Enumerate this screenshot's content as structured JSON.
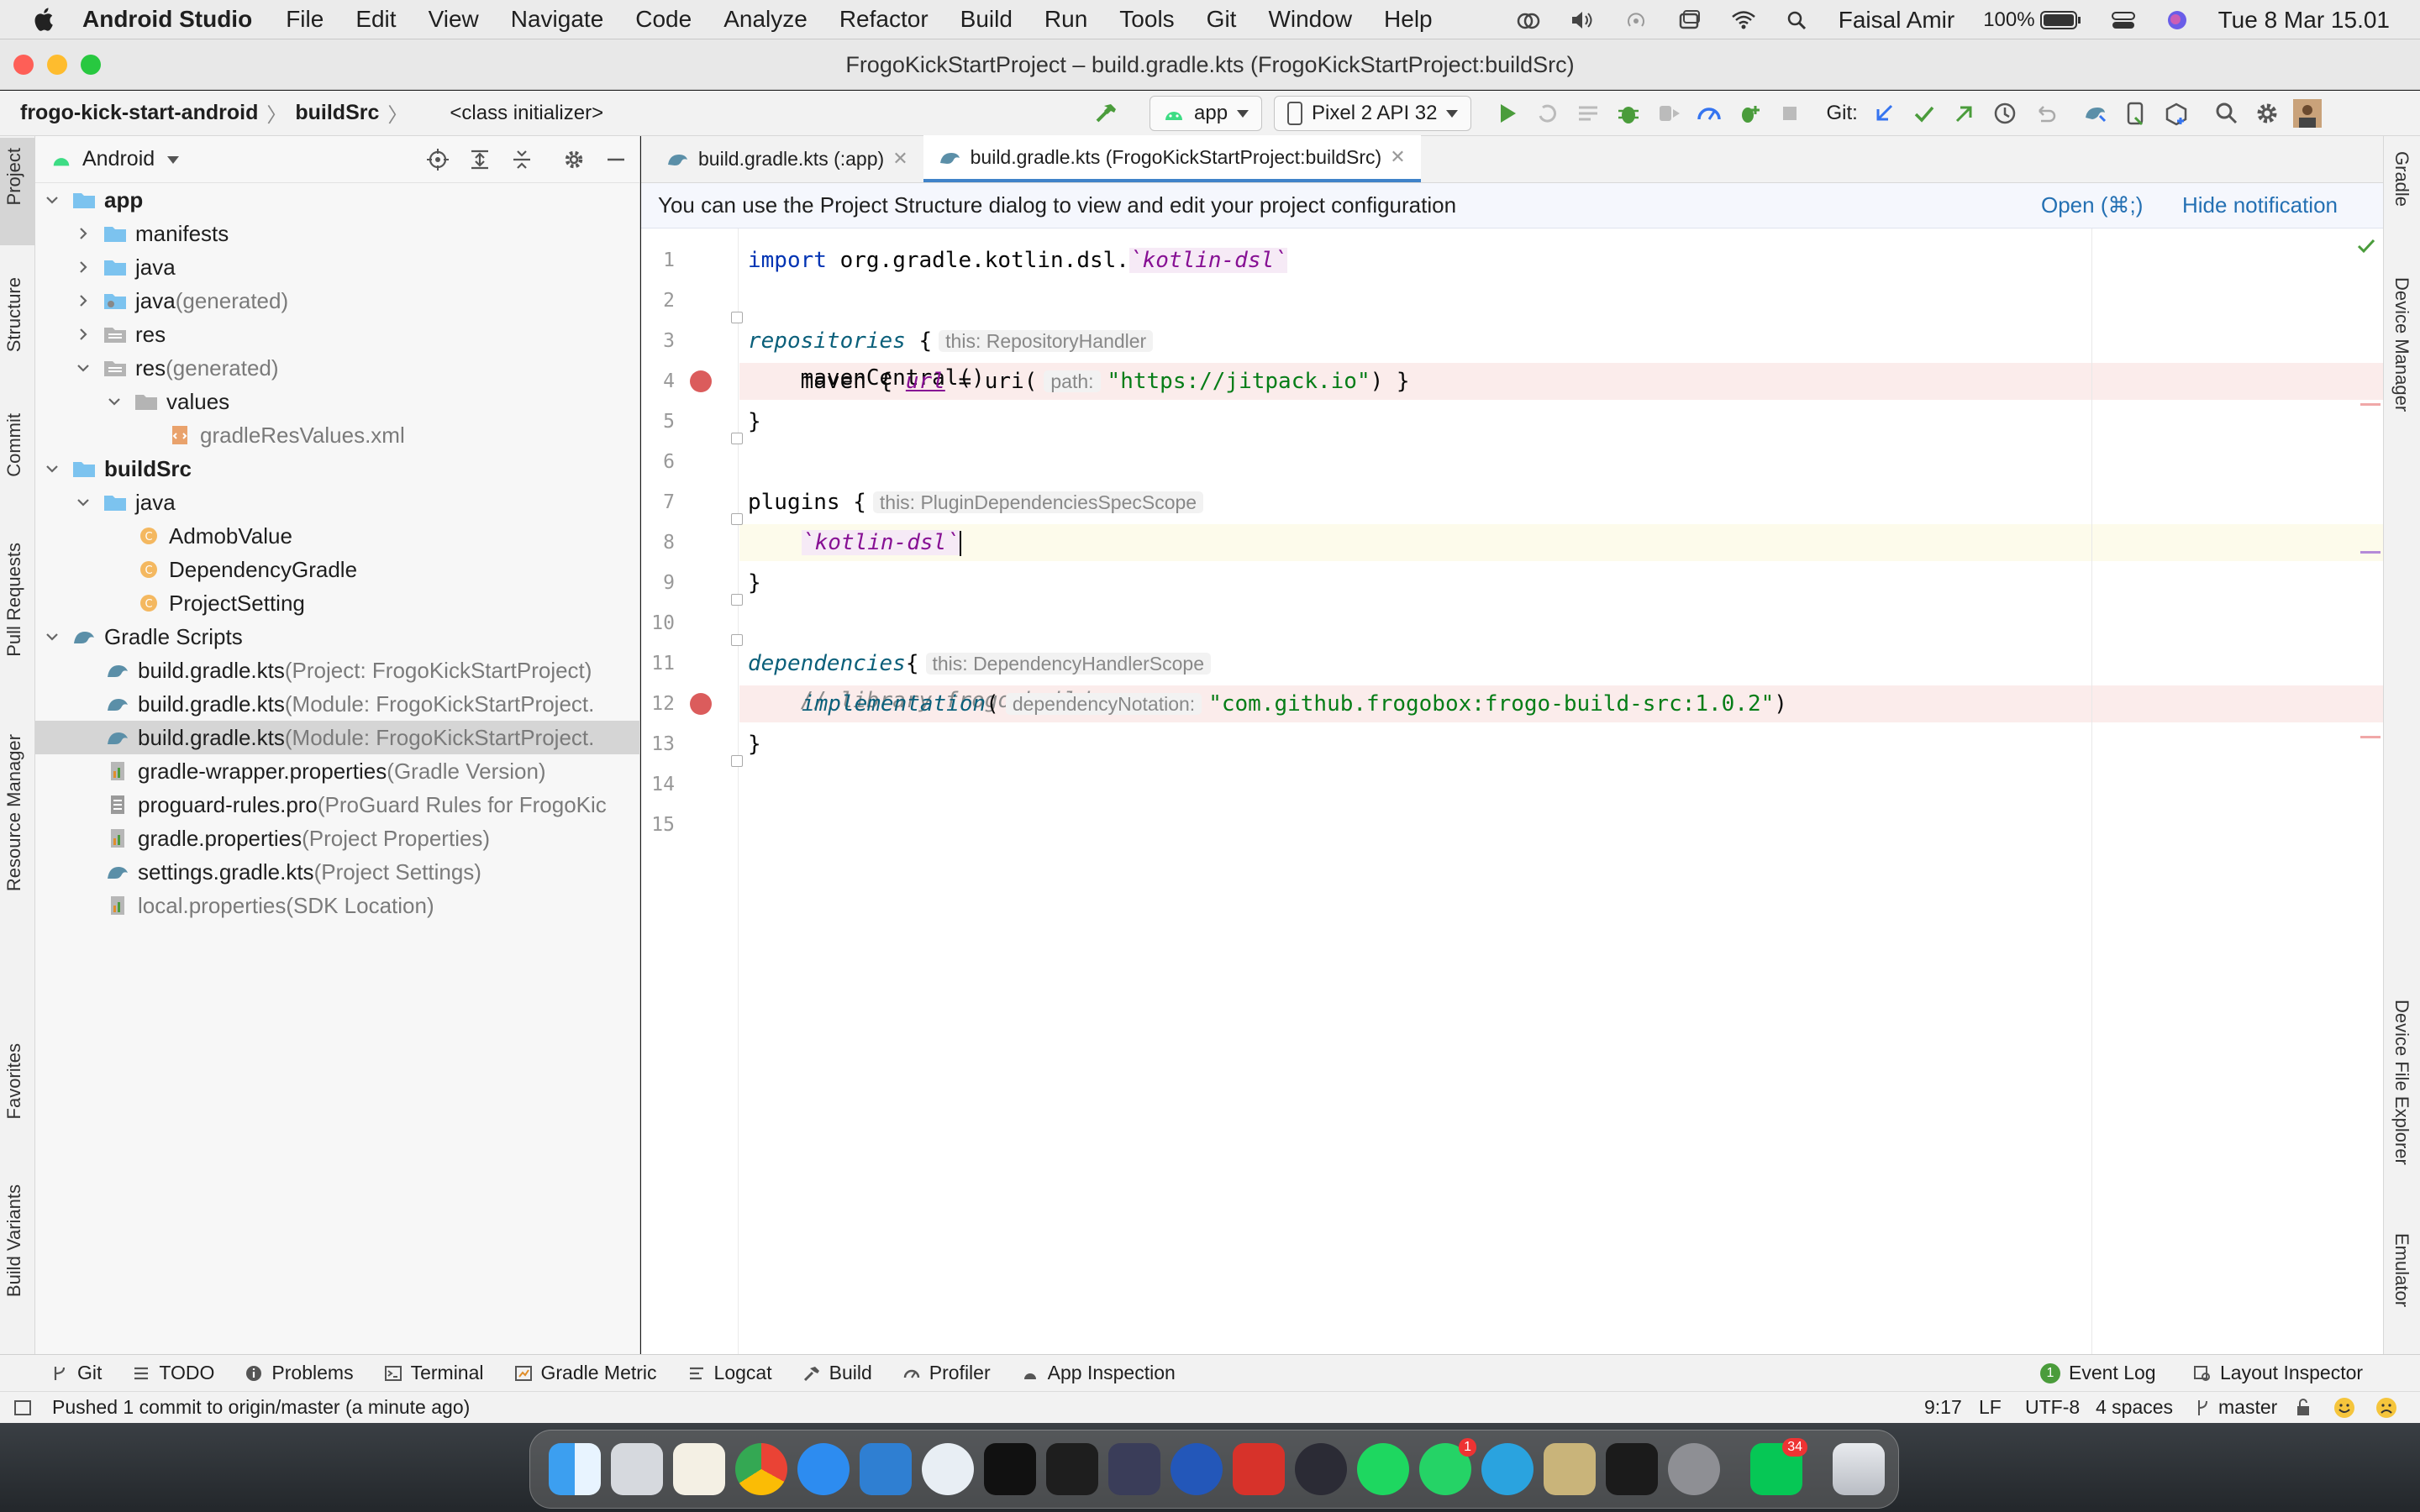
{
  "menubar": {
    "app_name": "Android Studio",
    "items": [
      "File",
      "Edit",
      "View",
      "Navigate",
      "Code",
      "Analyze",
      "Refactor",
      "Build",
      "Run",
      "Tools",
      "Git",
      "Window",
      "Help"
    ],
    "user": "Faisal Amir",
    "battery": "100%",
    "datetime": "Tue 8 Mar  15.01"
  },
  "window": {
    "title": "FrogoKickStartProject – build.gradle.kts (FrogoKickStartProject:buildSrc)"
  },
  "navbar": {
    "breadcrumbs": [
      "frogo-kick-start-android",
      "buildSrc",
      "<class initializer>"
    ],
    "run_config": "app",
    "device": "Pixel 2 API 32",
    "git_label": "Git:"
  },
  "left_tools": [
    "Project",
    "Structure",
    "Commit",
    "Pull Requests",
    "Resource Manager",
    "Favorites",
    "Build Variants"
  ],
  "right_tools": [
    "Gradle",
    "Device Manager",
    "Device File Explorer",
    "Emulator"
  ],
  "project": {
    "view_mode": "Android",
    "tree": [
      {
        "label": "app",
        "extra": "",
        "bold": true,
        "indent": 0,
        "chev": "down",
        "icon": "folder"
      },
      {
        "label": "manifests",
        "extra": "",
        "indent": 1,
        "chev": "right",
        "icon": "folder"
      },
      {
        "label": "java",
        "extra": "",
        "indent": 1,
        "chev": "right",
        "icon": "folder"
      },
      {
        "label": "java",
        "extra": " (generated)",
        "indent": 1,
        "chev": "right",
        "icon": "folder-gen"
      },
      {
        "label": "res",
        "extra": "",
        "indent": 1,
        "chev": "right",
        "icon": "folder-res"
      },
      {
        "label": "res",
        "extra": " (generated)",
        "indent": 1,
        "chev": "down",
        "icon": "folder-res"
      },
      {
        "label": "values",
        "extra": "",
        "indent": 2,
        "chev": "down",
        "icon": "folder-gray"
      },
      {
        "label": "gradleResValues.xml",
        "extra": "",
        "indent": 4,
        "chev": "",
        "icon": "xml",
        "grayLabel": true
      },
      {
        "label": "buildSrc",
        "extra": "",
        "bold": true,
        "indent": 0,
        "chev": "down",
        "icon": "folder"
      },
      {
        "label": "java",
        "extra": "",
        "indent": 1,
        "chev": "down",
        "icon": "folder"
      },
      {
        "label": "AdmobValue",
        "extra": "",
        "indent": 3,
        "chev": "",
        "icon": "class"
      },
      {
        "label": "DependencyGradle",
        "extra": "",
        "indent": 3,
        "chev": "",
        "icon": "class"
      },
      {
        "label": "ProjectSetting",
        "extra": "",
        "indent": 3,
        "chev": "",
        "icon": "class"
      },
      {
        "label": "Gradle Scripts",
        "extra": "",
        "indent": 0,
        "chev": "down",
        "icon": "gradle"
      },
      {
        "label": "build.gradle.kts",
        "extra": " (Project: FrogoKickStartProject)",
        "indent": 2,
        "chev": "",
        "icon": "gradle"
      },
      {
        "label": "build.gradle.kts",
        "extra": " (Module: FrogoKickStartProject.",
        "indent": 2,
        "chev": "",
        "icon": "gradle"
      },
      {
        "label": "build.gradle.kts",
        "extra": " (Module: FrogoKickStartProject.",
        "indent": 2,
        "chev": "",
        "icon": "gradle",
        "selected": true
      },
      {
        "label": "gradle-wrapper.properties",
        "extra": " (Gradle Version)",
        "indent": 2,
        "chev": "",
        "icon": "props"
      },
      {
        "label": "proguard-rules.pro",
        "extra": " (ProGuard Rules for FrogoKic",
        "indent": 2,
        "chev": "",
        "icon": "file"
      },
      {
        "label": "gradle.properties",
        "extra": " (Project Properties)",
        "indent": 2,
        "chev": "",
        "icon": "props"
      },
      {
        "label": "settings.gradle.kts",
        "extra": " (Project Settings)",
        "indent": 2,
        "chev": "",
        "icon": "gradle"
      },
      {
        "label": "local.properties",
        "extra": " (SDK Location)",
        "indent": 2,
        "chev": "",
        "icon": "props",
        "grayLabel": true
      }
    ]
  },
  "editor": {
    "tabs": [
      {
        "label": "build.gradle.kts (:app)",
        "active": false
      },
      {
        "label": "build.gradle.kts (FrogoKickStartProject:buildSrc)",
        "active": true
      }
    ],
    "notification": {
      "text": "You can use the Project Structure dialog to view and edit your project configuration",
      "open_link": "Open (⌘;)",
      "hide_link": "Hide notification"
    },
    "line_numbers": [
      "1",
      "2",
      "3",
      "4",
      "5",
      "6",
      "7",
      "8",
      "9",
      "10",
      "11",
      "12",
      "13",
      "14",
      "15"
    ],
    "code": {
      "l1_kw": "import",
      "l1_pkg": " org.gradle.kotlin.dsl.",
      "l1_bt": "`kotlin-dsl`",
      "l3_fn": "repositories",
      "l3_brace": " {",
      "l3_hint": "this: RepositoryHandler",
      "l4": "    mavenCentral()",
      "l5_a": "    maven { ",
      "l5_url": "url",
      "l5_b": " = uri(",
      "l5_hint": "path:",
      "l5_str": "\"https://jitpack.io\"",
      "l5_c": ") }",
      "l6": "}",
      "l8_fn": "plugins",
      "l8_brace": " {",
      "l8_hint": "this: PluginDependenciesSpecScope",
      "l9_bt": "`kotlin-dsl`",
      "l10": "}",
      "l12_fn": "dependencies",
      "l12_brace": "{",
      "l12_hint": "this: DependencyHandlerScope",
      "l13": "    // library frogo-build-src",
      "l14_fn": "implementation",
      "l14_paren": "(",
      "l14_hint": "dependencyNotation:",
      "l14_str": "\"com.github.frogobox:frogo-build-src:1.0.2\"",
      "l14_close": ")",
      "l15": "}"
    }
  },
  "bottom_tools": {
    "left": [
      "Git",
      "TODO",
      "Problems",
      "Terminal",
      "Gradle Metric",
      "Logcat",
      "Build",
      "Profiler",
      "App Inspection"
    ],
    "right": [
      "Event Log",
      "Layout Inspector"
    ],
    "event_count": "1"
  },
  "status": {
    "message": "Pushed 1 commit to origin/master (a minute ago)",
    "position": "9:17",
    "line_sep": "LF",
    "encoding": "UTF-8",
    "indent": "4 spaces",
    "branch": "master"
  },
  "dock": {
    "whatsapp_badge": "1",
    "line_badge": "34"
  },
  "colors": {
    "accent": "#4083c9",
    "breakpoint": "#db5c5c",
    "breakpoint_line": "#fbeceb",
    "link": "#2470b3"
  }
}
